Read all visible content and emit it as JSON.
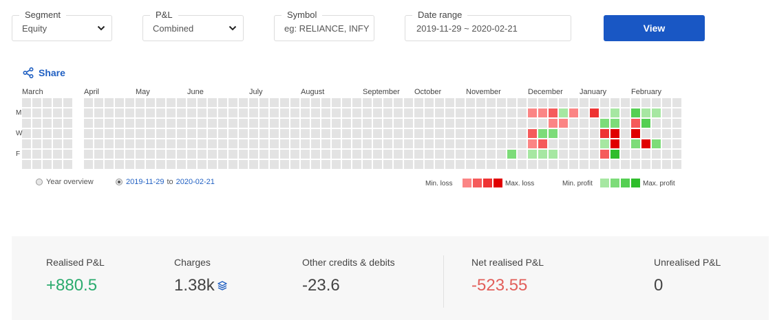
{
  "filters": {
    "segment": {
      "label": "Segment",
      "value": "Equity"
    },
    "pnl": {
      "label": "P&L",
      "value": "Combined"
    },
    "symbol": {
      "label": "Symbol",
      "placeholder": "eg: RELIANCE, INFY"
    },
    "date_range": {
      "label": "Date range",
      "value": "2019-11-29 ~ 2020-02-21"
    },
    "view_button": "View"
  },
  "share": {
    "label": "Share",
    "icon": "share-icon"
  },
  "heatmap": {
    "months": [
      "March",
      "April",
      "May",
      "June",
      "July",
      "August",
      "September",
      "October",
      "November",
      "December",
      "January",
      "February"
    ],
    "day_labels": [
      "M",
      "W",
      "F"
    ],
    "colors": {
      "empty": "#e3e3e3",
      "loss_1": "#fb8585",
      "loss_2": "#f55b5b",
      "loss_3": "#ee3333",
      "loss_4": "#e00000",
      "profit_1": "#a6e7a2",
      "profit_2": "#7ddc79",
      "profit_3": "#55cf53",
      "profit_4": "#2fbd2c"
    },
    "colored_cells": [
      {
        "month": "November",
        "week": 4,
        "day": 5,
        "level": "profit_2"
      },
      {
        "month": "December",
        "week": 0,
        "day": 1,
        "level": "loss_1"
      },
      {
        "month": "December",
        "week": 0,
        "day": 3,
        "level": "loss_2"
      },
      {
        "month": "December",
        "week": 0,
        "day": 4,
        "level": "loss_1"
      },
      {
        "month": "December",
        "week": 0,
        "day": 5,
        "level": "profit_1"
      },
      {
        "month": "December",
        "week": 1,
        "day": 1,
        "level": "loss_1"
      },
      {
        "month": "December",
        "week": 1,
        "day": 3,
        "level": "profit_2"
      },
      {
        "month": "December",
        "week": 1,
        "day": 4,
        "level": "loss_2"
      },
      {
        "month": "December",
        "week": 1,
        "day": 5,
        "level": "profit_1"
      },
      {
        "month": "December",
        "week": 2,
        "day": 1,
        "level": "loss_2"
      },
      {
        "month": "December",
        "week": 2,
        "day": 2,
        "level": "loss_1"
      },
      {
        "month": "December",
        "week": 2,
        "day": 3,
        "level": "profit_2"
      },
      {
        "month": "December",
        "week": 2,
        "day": 5,
        "level": "profit_1"
      },
      {
        "month": "December",
        "week": 3,
        "day": 1,
        "level": "profit_1"
      },
      {
        "month": "December",
        "week": 3,
        "day": 2,
        "level": "loss_1"
      },
      {
        "month": "December",
        "week": 4,
        "day": 1,
        "level": "loss_1"
      },
      {
        "month": "January",
        "week": 1,
        "day": 1,
        "level": "loss_3"
      },
      {
        "month": "January",
        "week": 2,
        "day": 2,
        "level": "profit_2"
      },
      {
        "month": "January",
        "week": 2,
        "day": 3,
        "level": "loss_3"
      },
      {
        "month": "January",
        "week": 2,
        "day": 4,
        "level": "profit_1"
      },
      {
        "month": "January",
        "week": 2,
        "day": 5,
        "level": "loss_2"
      },
      {
        "month": "January",
        "week": 3,
        "day": 1,
        "level": "profit_1"
      },
      {
        "month": "January",
        "week": 3,
        "day": 2,
        "level": "profit_2"
      },
      {
        "month": "January",
        "week": 3,
        "day": 3,
        "level": "loss_4"
      },
      {
        "month": "January",
        "week": 3,
        "day": 4,
        "level": "loss_4"
      },
      {
        "month": "January",
        "week": 3,
        "day": 5,
        "level": "profit_4"
      },
      {
        "month": "February",
        "week": 0,
        "day": 1,
        "level": "profit_3"
      },
      {
        "month": "February",
        "week": 0,
        "day": 2,
        "level": "loss_2"
      },
      {
        "month": "February",
        "week": 0,
        "day": 3,
        "level": "loss_4"
      },
      {
        "month": "February",
        "week": 0,
        "day": 4,
        "level": "profit_2"
      },
      {
        "month": "February",
        "week": 1,
        "day": 1,
        "level": "profit_1"
      },
      {
        "month": "February",
        "week": 1,
        "day": 2,
        "level": "profit_3"
      },
      {
        "month": "February",
        "week": 1,
        "day": 4,
        "level": "loss_4"
      },
      {
        "month": "February",
        "week": 2,
        "day": 1,
        "level": "profit_1"
      },
      {
        "month": "February",
        "week": 2,
        "day": 4,
        "level": "profit_2"
      }
    ]
  },
  "radios": {
    "year_overview": "Year overview",
    "range_from": "2019-11-29",
    "range_to_word": "to",
    "range_to": "2020-02-21"
  },
  "legend": {
    "min_loss": "Min. loss",
    "max_loss": "Max. loss",
    "min_profit": "Min. profit",
    "max_profit": "Max. profit"
  },
  "summary": {
    "realised": {
      "label": "Realised P&L",
      "value": "+880.5",
      "color": "#2bab6e"
    },
    "charges": {
      "label": "Charges",
      "value": "1.38k",
      "icon": "layers-icon",
      "color": "#444444"
    },
    "other": {
      "label": "Other credits & debits",
      "value": "-23.6",
      "color": "#444444"
    },
    "net": {
      "label": "Net realised P&L",
      "value": "-523.55",
      "color": "#e25f5b"
    },
    "unrealised": {
      "label": "Unrealised P&L",
      "value": "0",
      "color": "#444444"
    }
  }
}
